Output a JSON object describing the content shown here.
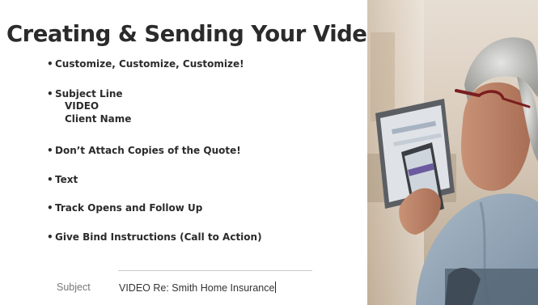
{
  "slide": {
    "title": "Creating & Sending Your Video",
    "bullets": [
      "Customize, Customize, Customize!",
      "Subject Line",
      "Don’t Attach Copies of the Quote!",
      "Text",
      "Track Opens and Follow Up",
      "Give Bind Instructions (Call to Action)"
    ],
    "subject_line_details": [
      "VIDEO",
      "Client Name"
    ]
  },
  "email": {
    "subject_label": "Subject",
    "subject_value": "VIDEO Re: Smith Home Insurance"
  }
}
